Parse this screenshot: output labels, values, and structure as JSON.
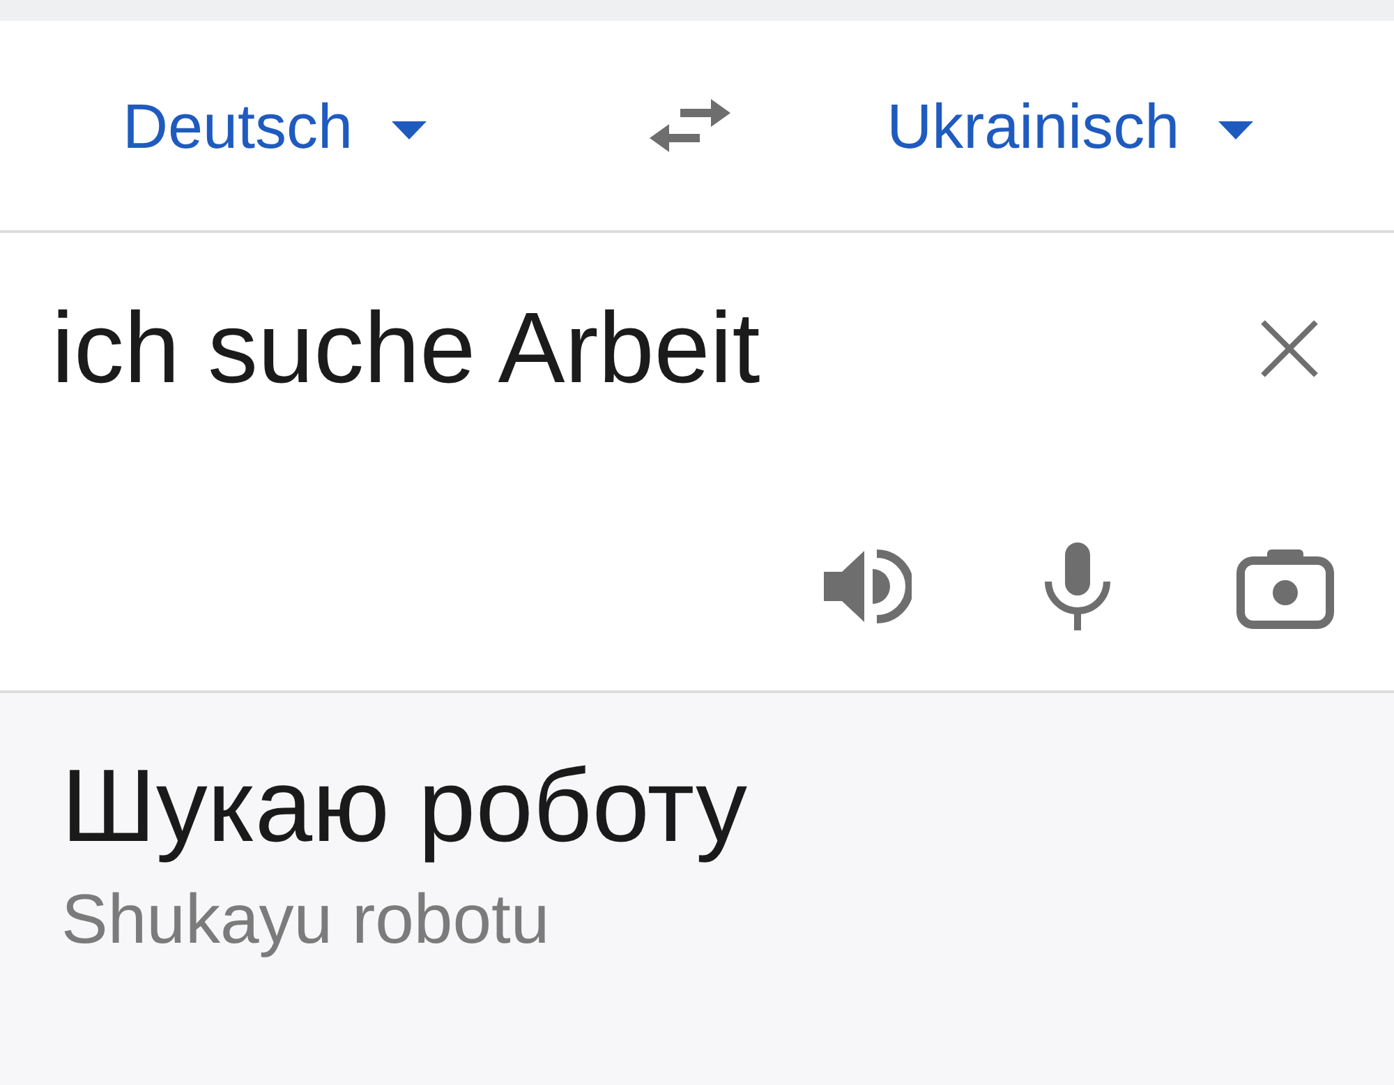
{
  "language_bar": {
    "source_language": "Deutsch",
    "target_language": "Ukrainisch"
  },
  "input": {
    "value": "ich suche Arbeit"
  },
  "translation": {
    "text": "Шукаю роботу",
    "transliteration": "Shukayu robotu"
  }
}
